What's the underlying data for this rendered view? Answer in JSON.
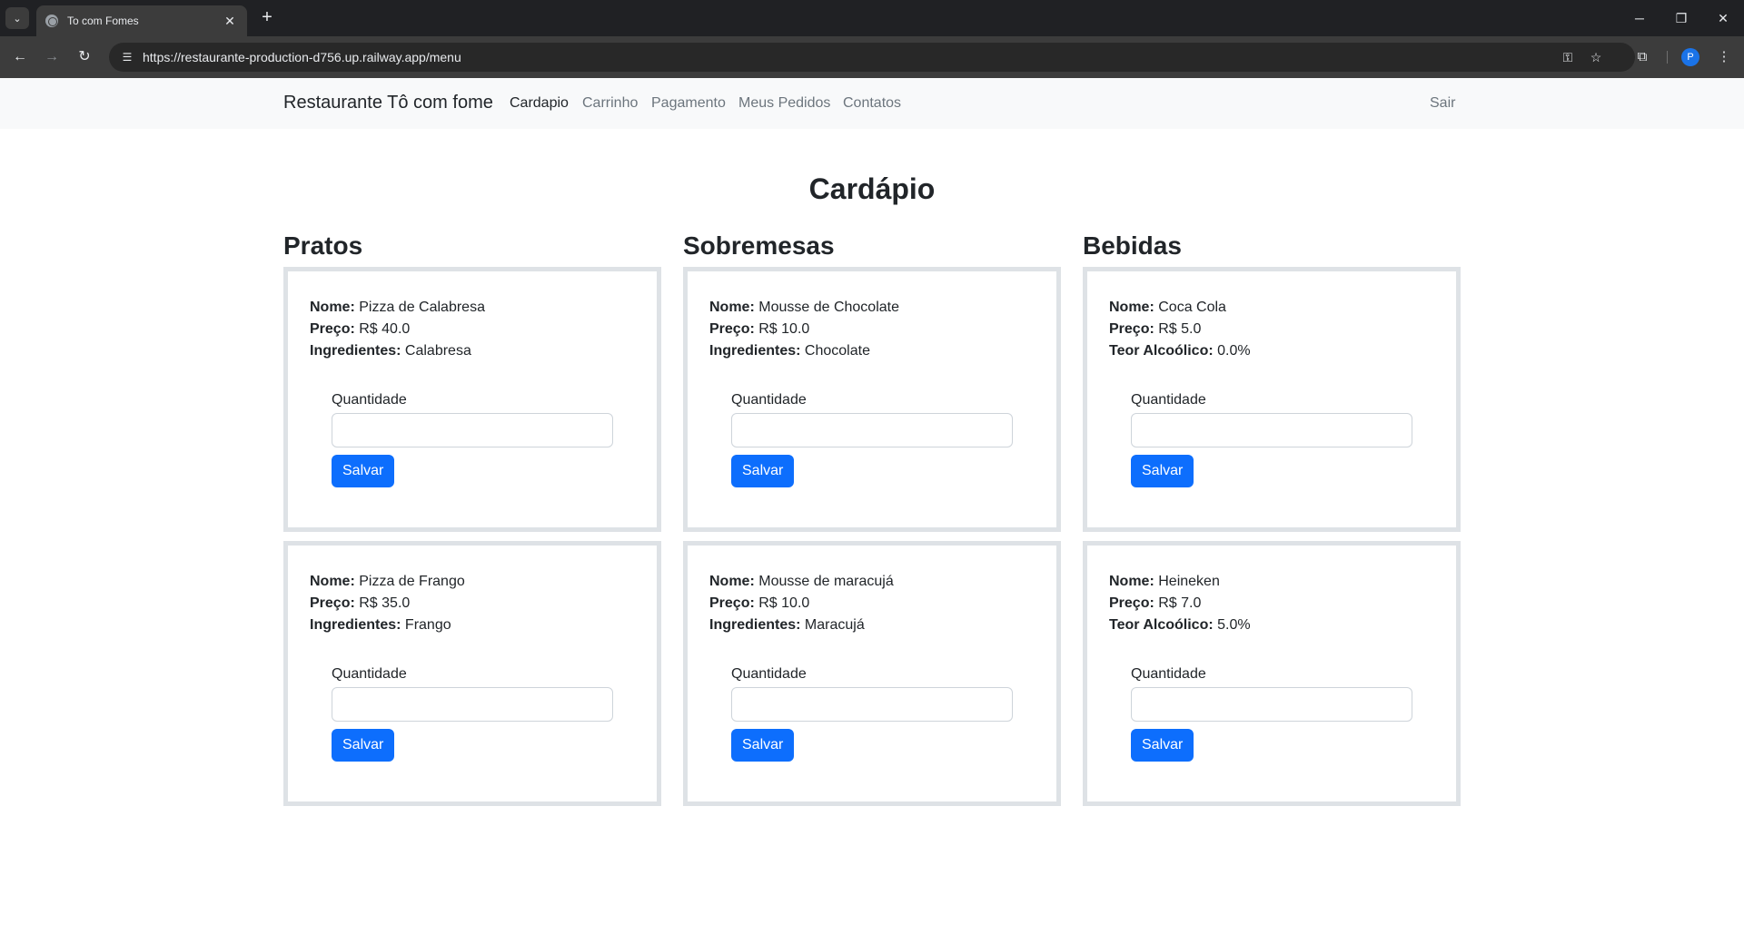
{
  "browser": {
    "tab_title": "To com Fomes",
    "url": "https://restaurante-production-d756.up.railway.app/menu",
    "profile_initial": "P"
  },
  "navbar": {
    "brand": "Restaurante Tô com fome",
    "links": [
      "Cardapio",
      "Carrinho",
      "Pagamento",
      "Meus Pedidos",
      "Contatos"
    ],
    "active": "Cardapio",
    "logout": "Sair"
  },
  "page": {
    "title": "Cardápio",
    "quantity_label": "Quantidade",
    "save_label": "Salvar"
  },
  "sections": [
    {
      "title": "Pratos",
      "items": [
        {
          "name_label": "Nome:",
          "name": "Pizza de Calabresa",
          "price_label": "Preço:",
          "price": "R$ 40.0",
          "extra_label": "Ingredientes:",
          "extra": "Calabresa"
        },
        {
          "name_label": "Nome:",
          "name": "Pizza de Frango",
          "price_label": "Preço:",
          "price": "R$ 35.0",
          "extra_label": "Ingredientes:",
          "extra": "Frango"
        }
      ]
    },
    {
      "title": "Sobremesas",
      "items": [
        {
          "name_label": "Nome:",
          "name": "Mousse de Chocolate",
          "price_label": "Preço:",
          "price": "R$ 10.0",
          "extra_label": "Ingredientes:",
          "extra": "Chocolate"
        },
        {
          "name_label": "Nome:",
          "name": "Mousse de maracujá",
          "price_label": "Preço:",
          "price": "R$ 10.0",
          "extra_label": "Ingredientes:",
          "extra": "Maracujá"
        }
      ]
    },
    {
      "title": "Bebidas",
      "items": [
        {
          "name_label": "Nome:",
          "name": "Coca Cola",
          "price_label": "Preço:",
          "price": "R$ 5.0",
          "extra_label": "Teor Alcoólico:",
          "extra": "0.0%"
        },
        {
          "name_label": "Nome:",
          "name": "Heineken",
          "price_label": "Preço:",
          "price": "R$ 7.0",
          "extra_label": "Teor Alcoólico:",
          "extra": "5.0%"
        }
      ]
    }
  ],
  "colors": {
    "primary": "#0d6efd",
    "card_border": "#dee2e6",
    "navbar_bg": "#f8f9fa"
  }
}
